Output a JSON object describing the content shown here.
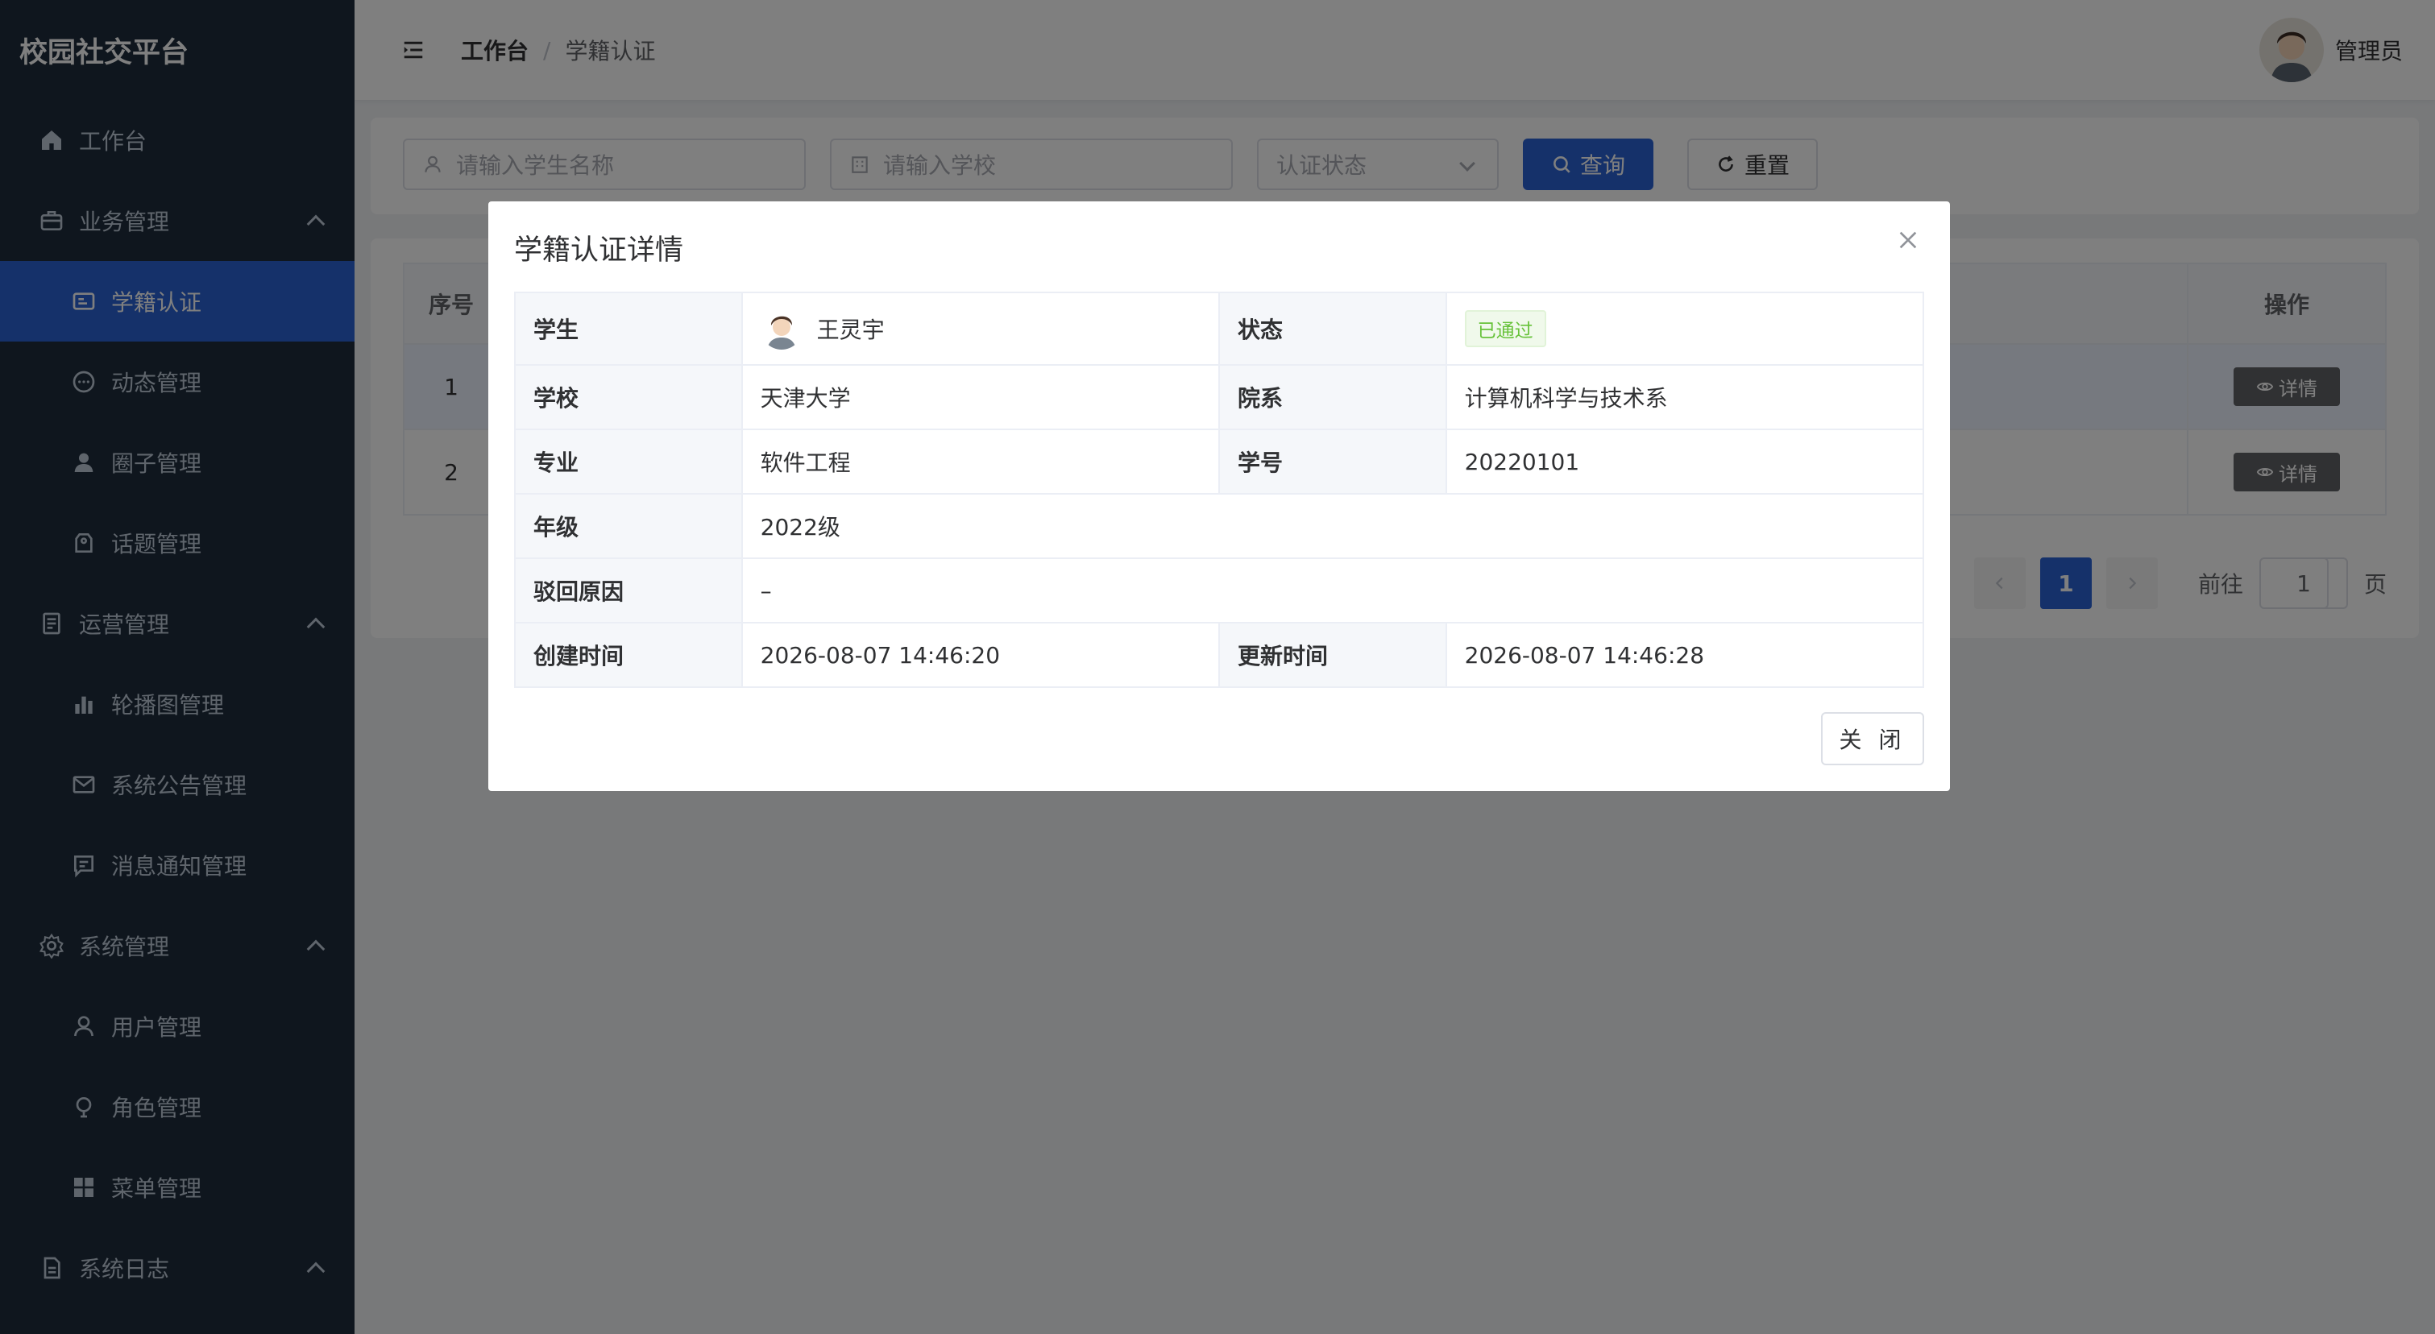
{
  "app": {
    "title": "校园社交平台"
  },
  "sidebar": {
    "items": [
      {
        "label": "工作台",
        "icon": "home-icon",
        "level": "top"
      },
      {
        "label": "业务管理",
        "icon": "briefcase-icon",
        "level": "top",
        "expanded": true
      },
      {
        "label": "学籍认证",
        "icon": "id-card-icon",
        "level": "sub",
        "active": true
      },
      {
        "label": "动态管理",
        "icon": "chat-bubble-icon",
        "level": "sub"
      },
      {
        "label": "圈子管理",
        "icon": "user-filled-icon",
        "level": "sub"
      },
      {
        "label": "话题管理",
        "icon": "tag-icon",
        "level": "sub"
      },
      {
        "label": "运营管理",
        "icon": "document-icon",
        "level": "top",
        "expanded": true
      },
      {
        "label": "轮播图管理",
        "icon": "bar-chart-icon",
        "level": "sub"
      },
      {
        "label": "系统公告管理",
        "icon": "mail-icon",
        "level": "sub"
      },
      {
        "label": "消息通知管理",
        "icon": "message-icon",
        "level": "sub"
      },
      {
        "label": "系统管理",
        "icon": "gear-icon",
        "level": "top",
        "expanded": true
      },
      {
        "label": "用户管理",
        "icon": "user-icon",
        "level": "sub"
      },
      {
        "label": "角色管理",
        "icon": "bulb-icon",
        "level": "sub"
      },
      {
        "label": "菜单管理",
        "icon": "grid-icon",
        "level": "sub"
      },
      {
        "label": "系统日志",
        "icon": "file-icon",
        "level": "top",
        "expanded": true
      }
    ]
  },
  "header": {
    "breadcrumb": [
      "工作台",
      "学籍认证"
    ],
    "separator": "/",
    "user_name": "管理员"
  },
  "search": {
    "student_placeholder": "请输入学生名称",
    "school_placeholder": "请输入学校",
    "status_placeholder": "认证状态",
    "query_label": "查询",
    "reset_label": "重置"
  },
  "table": {
    "columns": {
      "index": "序号",
      "action": "操作"
    },
    "rows": [
      {
        "index": "1",
        "action_label": "详情"
      },
      {
        "index": "2",
        "action_label": "详情"
      }
    ]
  },
  "pagination": {
    "current_page": "1",
    "goto_label": "前往",
    "goto_value": "1",
    "page_suffix": "页"
  },
  "dialog": {
    "title": "学籍认证详情",
    "fields": {
      "student_label": "学生",
      "student_name": "王灵宇",
      "status_label": "状态",
      "status_value": "已通过",
      "school_label": "学校",
      "school_value": "天津大学",
      "department_label": "院系",
      "department_value": "计算机科学与技术系",
      "major_label": "专业",
      "major_value": "软件工程",
      "student_no_label": "学号",
      "student_no_value": "20220101",
      "grade_label": "年级",
      "grade_value": "2022级",
      "reject_reason_label": "驳回原因",
      "reject_reason_value": "–",
      "created_label": "创建时间",
      "created_value": "2026-08-07 14:46:20",
      "updated_label": "更新时间",
      "updated_value": "2026-08-07 14:46:28"
    },
    "close_label": "关 闭"
  },
  "colors": {
    "sidebar_bg": "#1f2d3d",
    "primary": "#2a62d4",
    "success": "#67c23a",
    "overlay": "rgba(0,0,0,0.5)"
  }
}
